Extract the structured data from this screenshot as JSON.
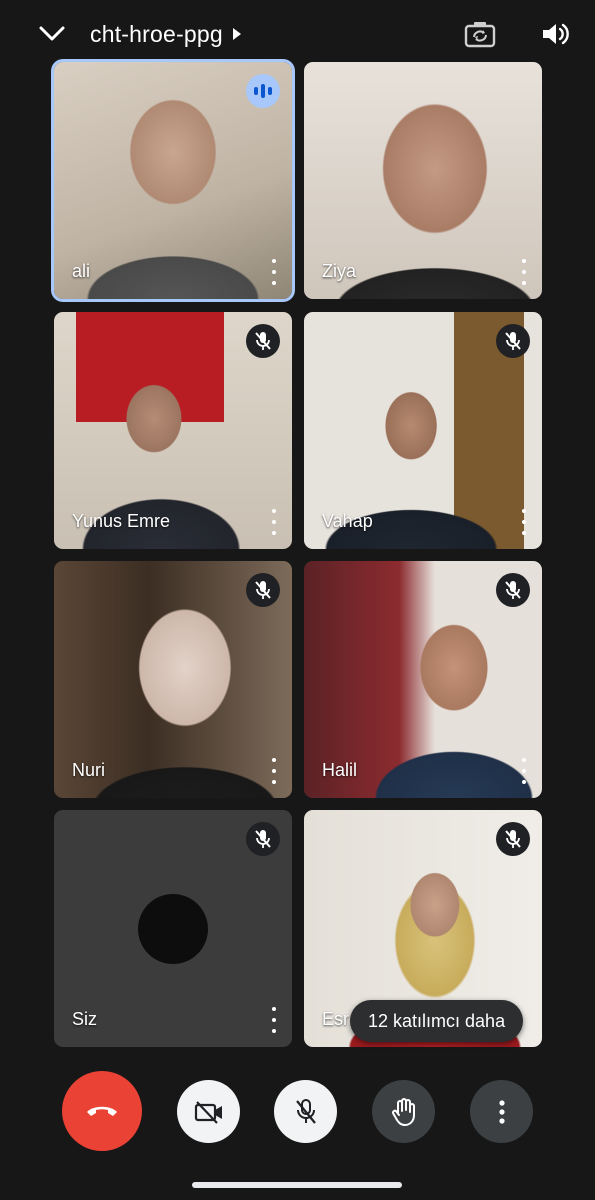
{
  "header": {
    "meeting_code": "cht-hroe-ppg",
    "back_icon": "chevron-down-icon",
    "switch_camera_icon": "switch-camera-icon",
    "audio_icon": "speaker-icon"
  },
  "tiles": [
    {
      "name": "ali",
      "state": "speaking"
    },
    {
      "name": "Ziya",
      "state": "unmuted"
    },
    {
      "name": "Yunus Emre",
      "state": "muted"
    },
    {
      "name": "Vahap",
      "state": "muted"
    },
    {
      "name": "Nuri",
      "state": "muted"
    },
    {
      "name": "Halil",
      "state": "muted"
    },
    {
      "name": "Siz",
      "state": "muted"
    },
    {
      "name": "Esr",
      "state": "muted"
    }
  ],
  "overflow": {
    "label": "12 katılımcı daha"
  },
  "controls": {
    "end_call_icon": "hang-up-icon",
    "camera_icon": "camera-off-icon",
    "mic_icon": "mic-off-icon",
    "hand_icon": "raise-hand-icon",
    "more_icon": "more-vertical-icon"
  },
  "colors": {
    "background": "#171717",
    "active_speaker": "#a8c7fa",
    "end_call": "#ea4335"
  }
}
